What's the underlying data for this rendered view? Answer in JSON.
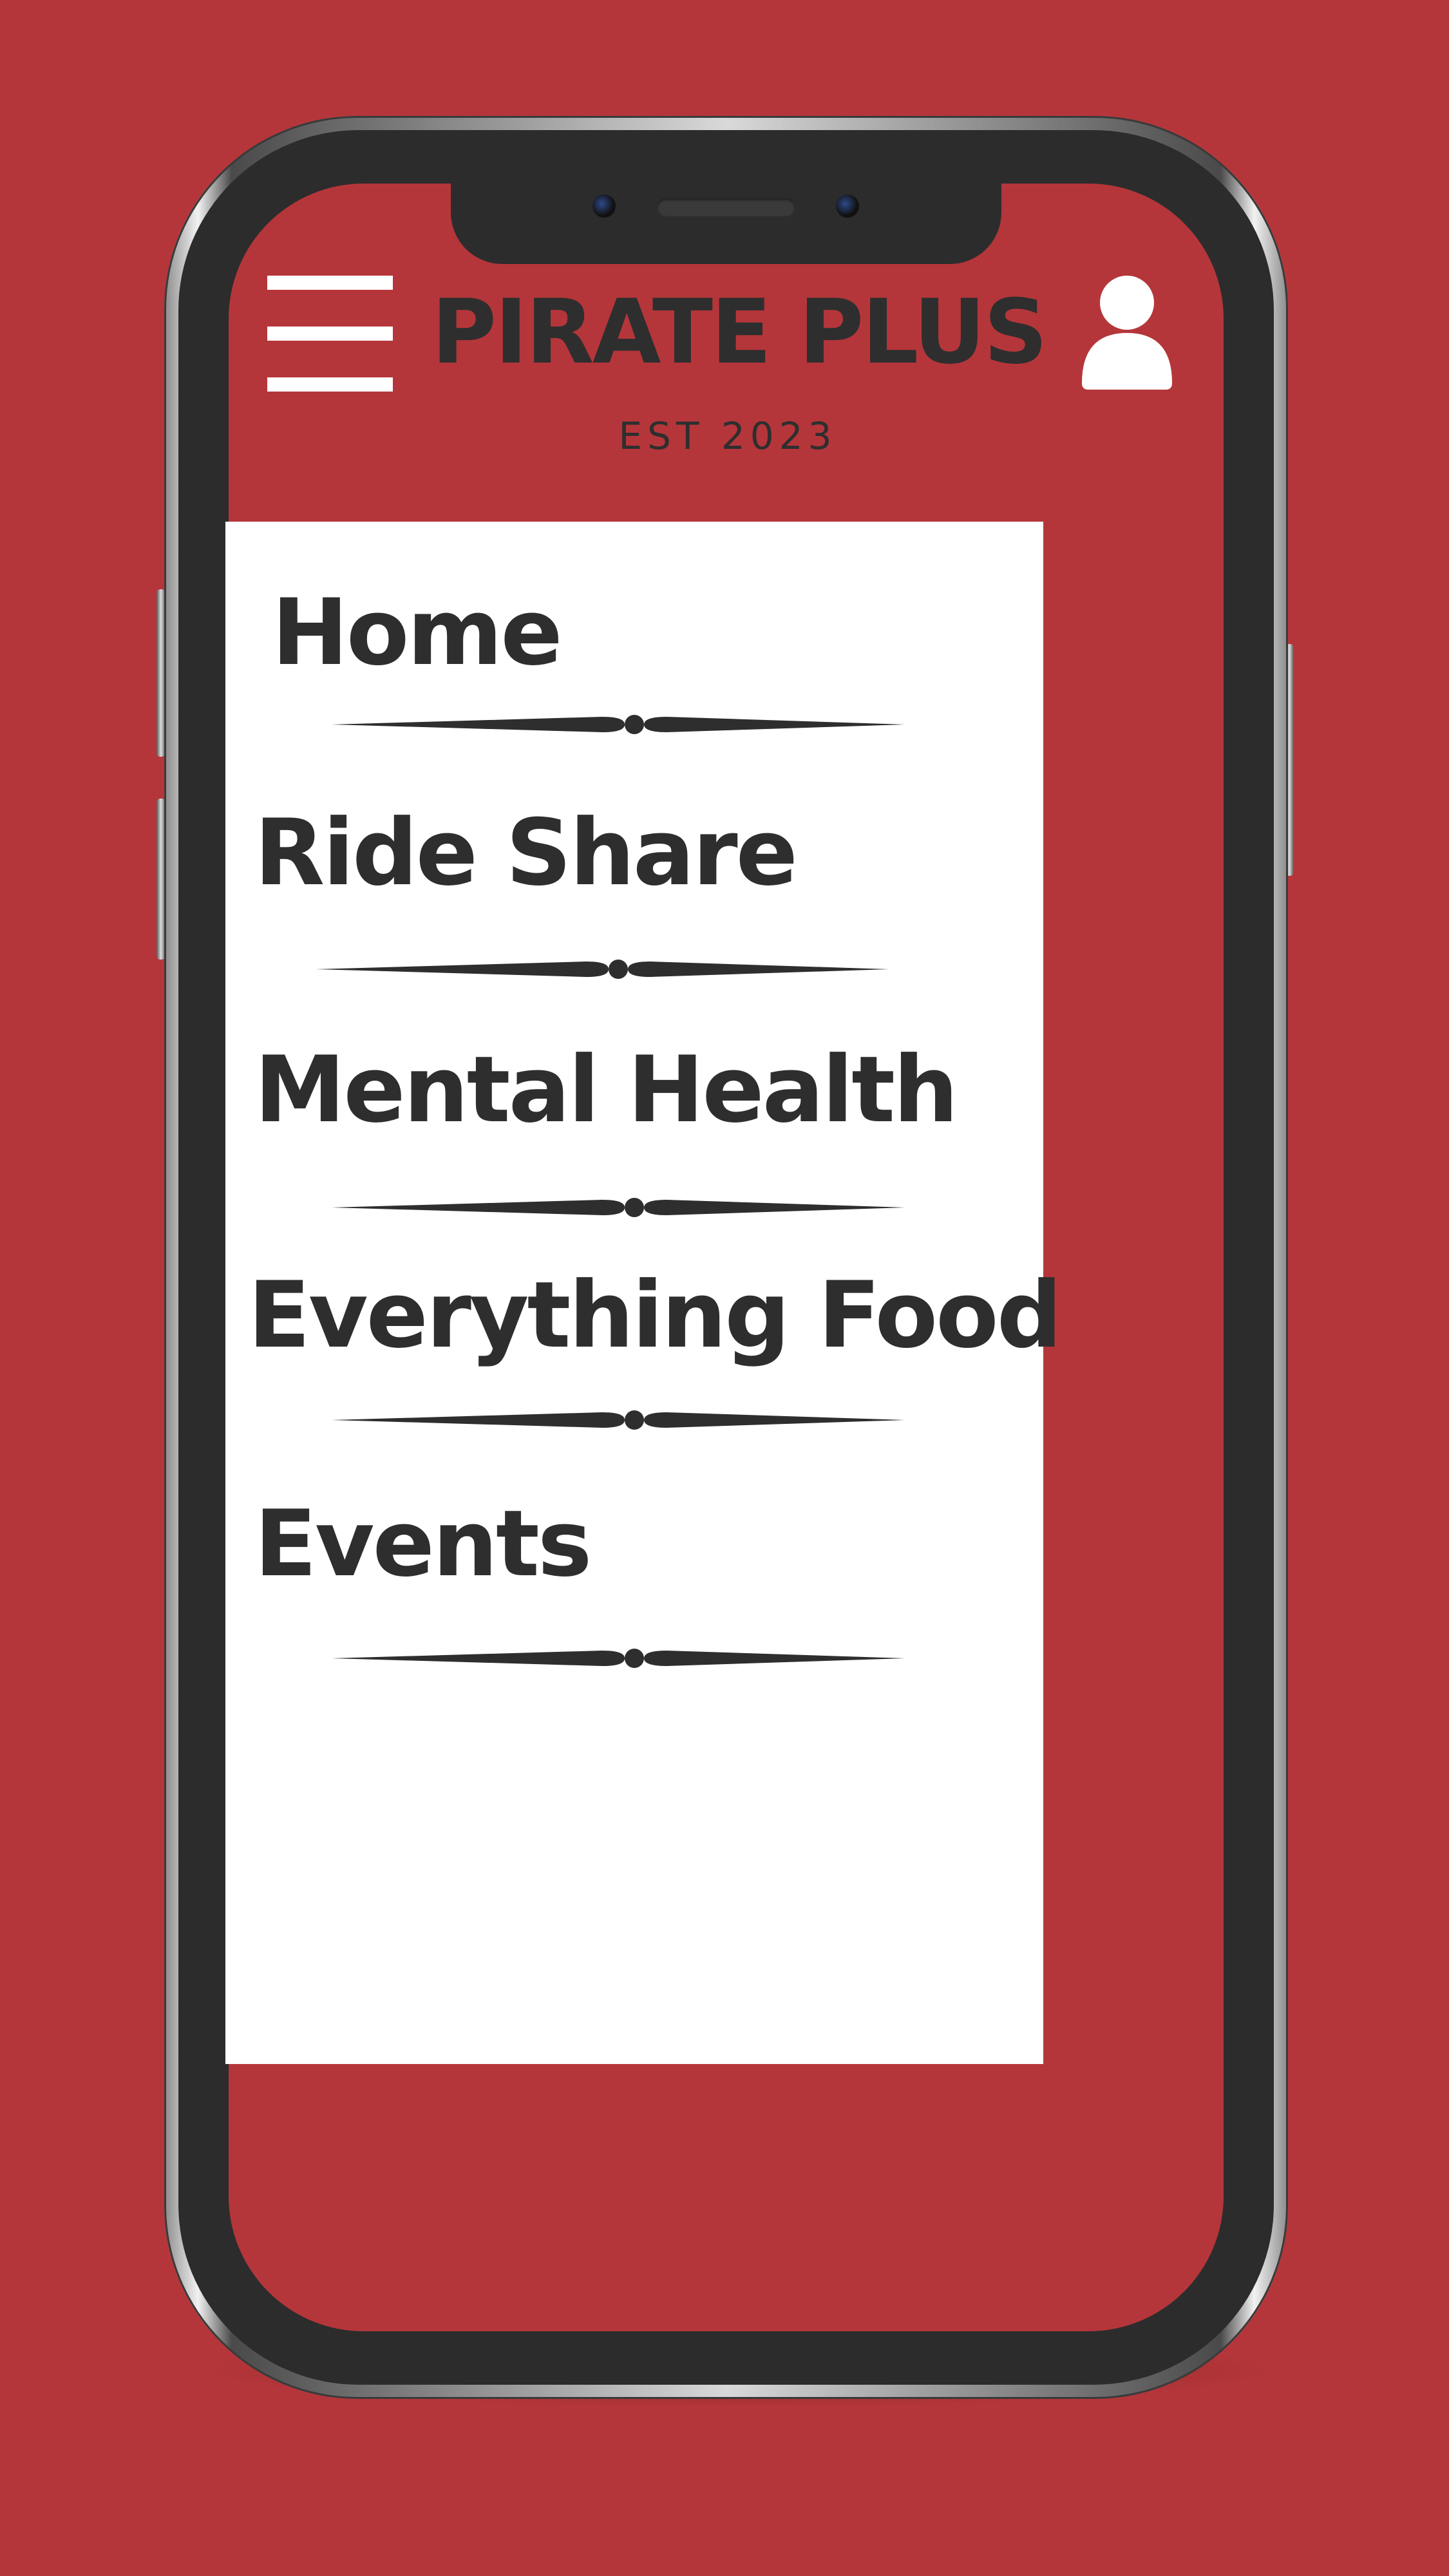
{
  "app": {
    "title": "PIRATE PLUS",
    "subtitle": "EST 2023"
  },
  "header": {
    "menu_icon": "hamburger-menu-icon",
    "profile_icon": "user-profile-icon"
  },
  "menu": {
    "items": [
      {
        "label": "Home"
      },
      {
        "label": "Ride Share"
      },
      {
        "label": "Mental Health"
      },
      {
        "label": "Everything Food"
      },
      {
        "label": "Events"
      }
    ]
  },
  "colors": {
    "background": "#b5363a",
    "text": "#2e2e2e",
    "panel": "#ffffff"
  }
}
